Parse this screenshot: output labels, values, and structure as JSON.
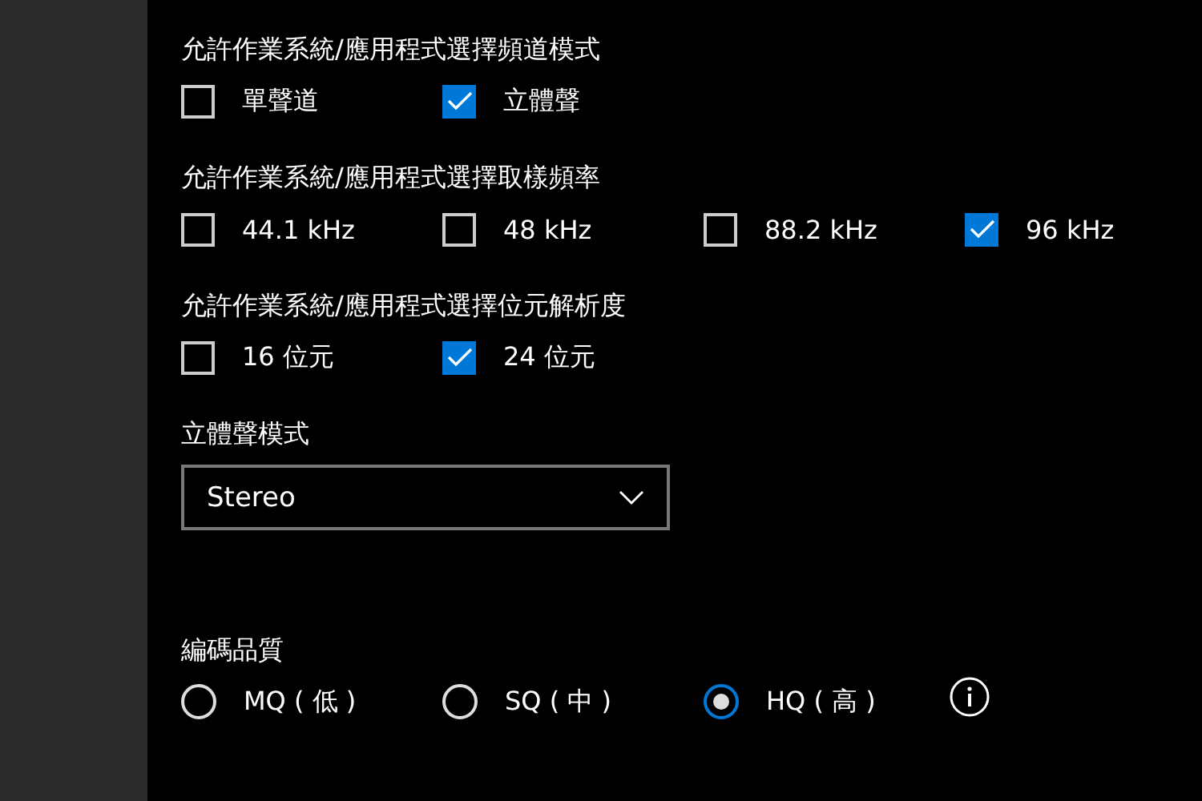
{
  "groups": [
    {
      "label": "允許作業系統/應用程式選擇頻道模式",
      "options": [
        {
          "label": "單聲道",
          "checked": false
        },
        {
          "label": "立體聲",
          "checked": true
        }
      ]
    },
    {
      "label": "允許作業系統/應用程式選擇取樣頻率",
      "options": [
        {
          "label": "44.1 kHz",
          "checked": false
        },
        {
          "label": "48 kHz",
          "checked": false
        },
        {
          "label": "88.2 kHz",
          "checked": false
        },
        {
          "label": "96 kHz",
          "checked": true
        }
      ]
    },
    {
      "label": "允許作業系統/應用程式選擇位元解析度",
      "options": [
        {
          "label": "16 位元",
          "checked": false
        },
        {
          "label": "24 位元",
          "checked": true
        }
      ]
    }
  ],
  "stereo_mode": {
    "label": "立體聲模式",
    "value": "Stereo"
  },
  "encoding_quality": {
    "label": "編碼品質",
    "options": [
      {
        "label": "MQ ( 低 )",
        "selected": false
      },
      {
        "label": "SQ ( 中 )",
        "selected": false
      },
      {
        "label": "HQ ( 高 )",
        "selected": true
      }
    ]
  }
}
